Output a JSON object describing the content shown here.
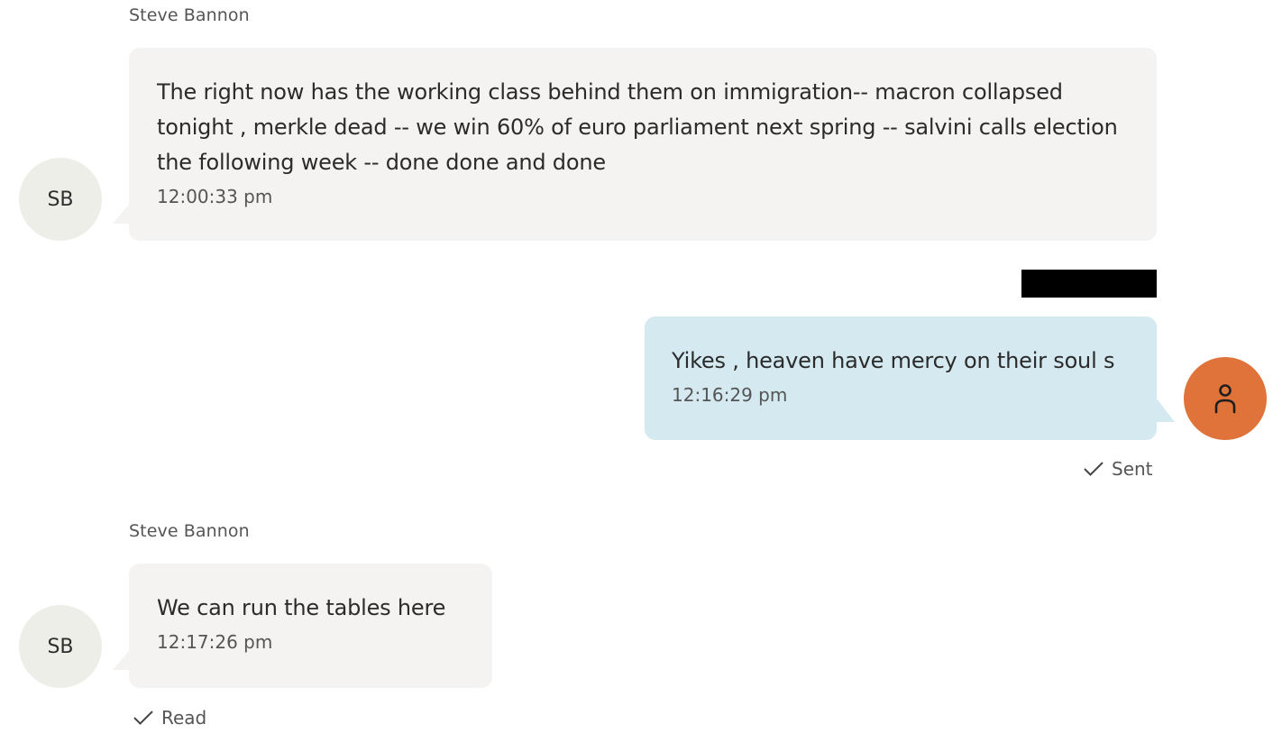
{
  "messages": [
    {
      "sender": "Steve Bannon",
      "initials": "SB",
      "text": "The right now has the working class behind them on immigration-- macron collapsed tonight , merkle dead -- we win 60% of euro parliament next spring -- salvini calls election the following week -- done done and done",
      "time": "12:00:33 pm"
    },
    {
      "text": "Yikes , heaven have mercy on their soul s",
      "time": "12:16:29 pm",
      "status": "Sent",
      "avatar_icon": "user-icon"
    },
    {
      "sender": "Steve Bannon",
      "initials": "SB",
      "text": "We can run the tables here",
      "time": "12:17:26 pm",
      "status": "Read"
    }
  ],
  "colors": {
    "incoming_bubble": "#f4f3f2",
    "outgoing_bubble": "#d4e9f0",
    "self_avatar": "#e0733a",
    "contact_avatar": "#eeeee8",
    "redaction": "#000000"
  },
  "icons": {
    "status": "checkmark-icon",
    "self_avatar": "user-icon"
  }
}
